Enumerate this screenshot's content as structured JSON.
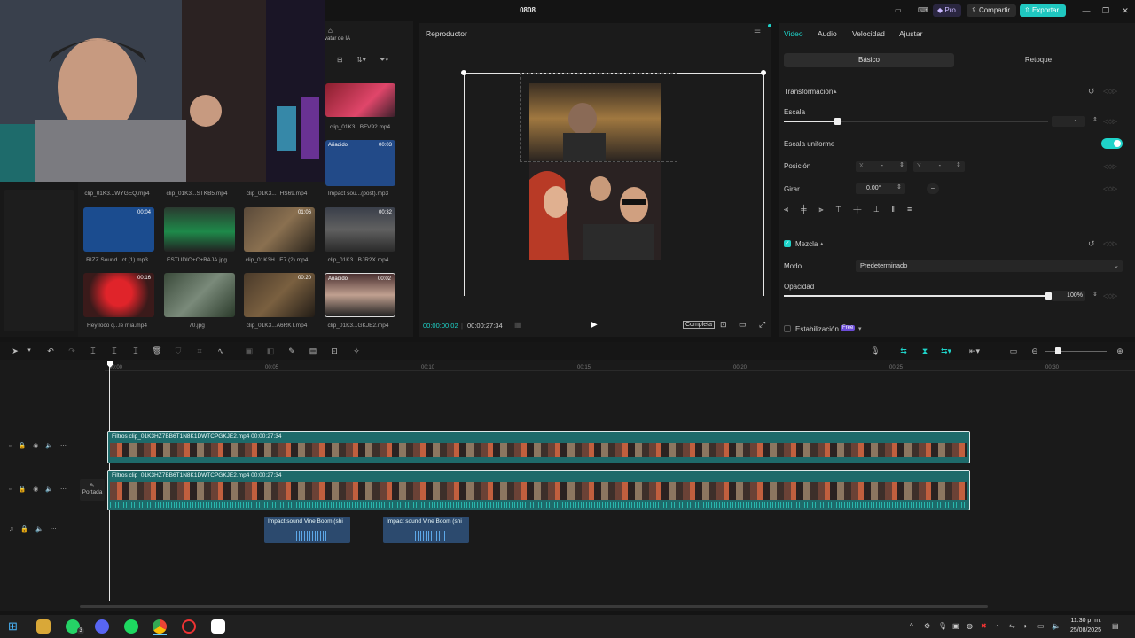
{
  "window": {
    "title": "0808",
    "pro_label": "Pro",
    "share_label": "Compartir",
    "export_label": "Exportar"
  },
  "media": {
    "ai_label": "vatar de IA",
    "row1": [
      {
        "caption": "clip_01K3...BFV92.mp4"
      },
      {
        "caption": "Impact sou...(post).mp3",
        "badge": "Añadido",
        "duration": "00:03"
      }
    ],
    "row2_captions": [
      "clip_01K3...WYGEQ.mp4",
      "clip_01K3...STKB5.mp4",
      "clip_01K3...THS69.mp4"
    ],
    "row3": [
      {
        "caption": "RIZZ Sound...ct (1).mp3",
        "duration": "00:04"
      },
      {
        "caption": "ESTUDIO+C+BAJA.jpg",
        "duration": ""
      },
      {
        "caption": "clip_01K3H...E7 (2).mp4",
        "duration": "01:06"
      },
      {
        "caption": "clip_01K3...BJR2X.mp4",
        "duration": "00:32"
      }
    ],
    "row4": [
      {
        "caption": "Hey loco q...le mia.mp4",
        "duration": "00:16"
      },
      {
        "caption": "70.jpg",
        "duration": ""
      },
      {
        "caption": "clip_01K3...A6RKT.mp4",
        "duration": "00:20"
      },
      {
        "caption": "clip_01K3...GKJE2.mp4",
        "duration": "00:02",
        "badge": "Añadido"
      }
    ]
  },
  "player": {
    "title": "Reproductor",
    "current_time": "00:00:00:02",
    "total_time": "00:00:27:34",
    "ratio_label": "Completa"
  },
  "inspector": {
    "tabs": [
      "Video",
      "Audio",
      "Velocidad",
      "Ajustar"
    ],
    "subtabs": [
      "Básico",
      "Retoque"
    ],
    "transform_label": "Transformación",
    "scale_label": "Escala",
    "scale_value": "-",
    "scale_fraction": 0.2,
    "uniform_label": "Escala uniforme",
    "position_label": "Posición",
    "x_label": "X",
    "x_value": "-",
    "y_label": "Y",
    "y_value": "-",
    "rotate_label": "Girar",
    "rotate_value": "0.00°",
    "rotate_knob": "–",
    "blend_label": "Mezcla",
    "mode_label": "Modo",
    "mode_value": "Predeterminado",
    "opacity_label": "Opacidad",
    "opacity_value": "100%",
    "opacity_fraction": 1.0,
    "stabilization_label": "Estabilización",
    "free_badge": "Free",
    "accent_color": "#1fd3c9"
  },
  "timeline": {
    "ticks": [
      "00:00",
      "00:05",
      "00:10",
      "00:15",
      "00:20",
      "00:25",
      "00:30"
    ],
    "cover_label": "Portada",
    "clips": [
      {
        "label": "Filtros  clip_01K3HZ7BB6T1N8K1DWTCPGKJE2.mp4  00:00:27:34"
      },
      {
        "label": "Filtros  clip_01K3HZ7BB6T1N8K1DWTCPGKJE2.mp4  00:00:27:34"
      }
    ],
    "audio_clips": [
      {
        "label": "Impact sound  Vine Boom (shi"
      },
      {
        "label": "Impact sound  Vine Boom (shi"
      }
    ]
  },
  "taskbar": {
    "time": "11:30 p. m.",
    "date": "25/08/2025",
    "whatsapp_badge": "3"
  }
}
